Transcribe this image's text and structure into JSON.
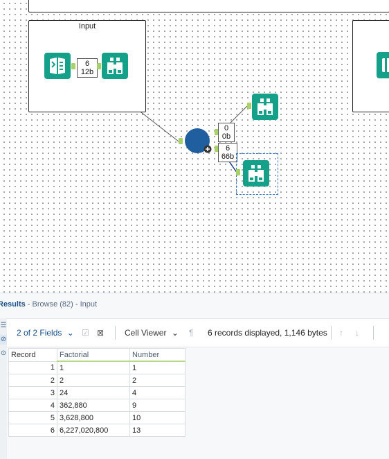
{
  "canvas": {
    "container_title": "Input",
    "input_connection": {
      "records": "6",
      "bytes": "12b"
    },
    "true_connection": {
      "records": "0",
      "bytes": "0b"
    },
    "false_connection": {
      "records": "6",
      "bytes": "66b"
    },
    "icons": {
      "input_tool": "book-icon",
      "browse_tool": "binoculars-icon",
      "python_tool": "circle-tool-icon",
      "add_badge": "plus-icon"
    }
  },
  "results": {
    "title_bold": "Results",
    "title_rest": " - Browse (82) - Input",
    "fields_label": "2 of 2 Fields",
    "cell_viewer_label": "Cell Viewer",
    "records_info": "6 records displayed, 1,146 bytes"
  },
  "table": {
    "headers": [
      "Record",
      "Factorial",
      "Number"
    ],
    "rows": [
      [
        "1",
        "1",
        "1"
      ],
      [
        "2",
        "2",
        "2"
      ],
      [
        "3",
        "24",
        "4"
      ],
      [
        "4",
        "362,880",
        "9"
      ],
      [
        "5",
        "3,628,800",
        "10"
      ],
      [
        "6",
        "6,227,020,800",
        "13"
      ]
    ]
  },
  "colors": {
    "tool_teal": "#15a189",
    "anchor_green": "#a8d16a",
    "python_blue": "#1f5fa0",
    "accent_blue": "#1e4f86"
  }
}
